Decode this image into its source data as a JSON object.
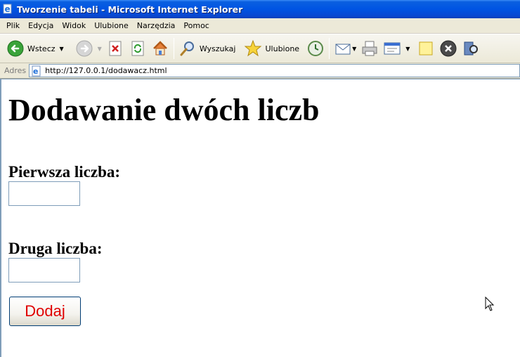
{
  "window": {
    "title": "Tworzenie tabeli - Microsoft Internet Explorer"
  },
  "menu": [
    "Plik",
    "Edycja",
    "Widok",
    "Ulubione",
    "Narzędzia",
    "Pomoc"
  ],
  "toolbar": {
    "back_label": "Wstecz",
    "search_label": "Wyszukaj",
    "favorites_label": "Ulubione"
  },
  "address": {
    "label": "Adres",
    "url": "http://127.0.0.1/dodawacz.html"
  },
  "page": {
    "heading": "Dodawanie dwóch liczb",
    "first_label": "Pierwsza liczba:",
    "first_value": "",
    "second_label": "Druga liczba:",
    "second_value": "",
    "submit_label": "Dodaj"
  },
  "colors": {
    "titlebar": "#0054e3",
    "submit_text": "#e00000"
  }
}
